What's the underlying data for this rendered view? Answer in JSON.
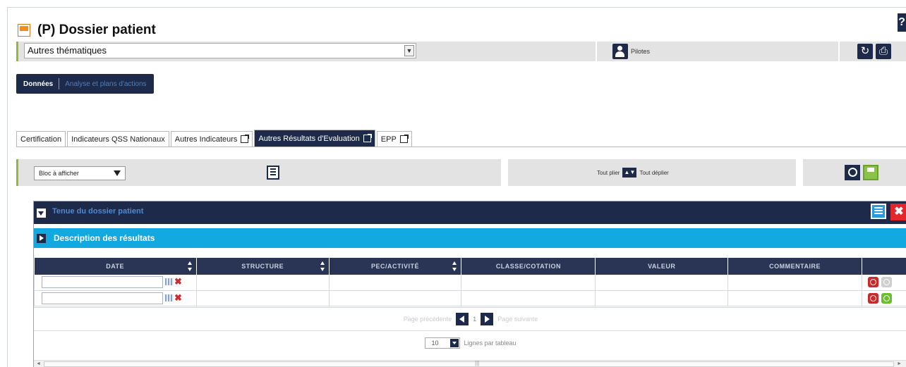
{
  "header": {
    "title": "(P) Dossier patient",
    "help": "?"
  },
  "theme": {
    "selected": "Autres thématiques",
    "pilotes_label": "Pilotes"
  },
  "nav": {
    "active": "Données",
    "inactive": "Analyse et plans d'actions"
  },
  "subtabs": [
    {
      "label": "Certification",
      "ext": false
    },
    {
      "label": "Indicateurs QSS Nationaux",
      "ext": false
    },
    {
      "label": "Autres Indicateurs",
      "ext": true
    },
    {
      "label": "Autres Résultats d'Evaluation",
      "ext": true,
      "active": true
    },
    {
      "label": "EPP",
      "ext": true
    }
  ],
  "toolbar": {
    "bloc_select": "Bloc à afficher",
    "fold": "Tout plier",
    "unfold": "Tout déplier"
  },
  "panel": {
    "title": "Tenue du dossier patient",
    "section": "Description des résultats",
    "close": "✖"
  },
  "table": {
    "columns": [
      "DATE",
      "STRUCTURE",
      "PEC/ACTIVITÉ",
      "CLASSE/COTATION",
      "VALEUR",
      "COMMENTAIRE"
    ],
    "row_count": 2
  },
  "pager": {
    "prev": "Page précédente",
    "page": "1",
    "next": "Page suivante"
  },
  "lines": {
    "value": "10",
    "label": "Lignes par tableau"
  },
  "scroll": {
    "left": "◄",
    "right": "►",
    "grip": "|||"
  },
  "colors": {
    "navy": "#1e2a4a",
    "accent_green": "#8bbd3b",
    "cyan": "#12a8e0",
    "danger": "#e5262b"
  }
}
